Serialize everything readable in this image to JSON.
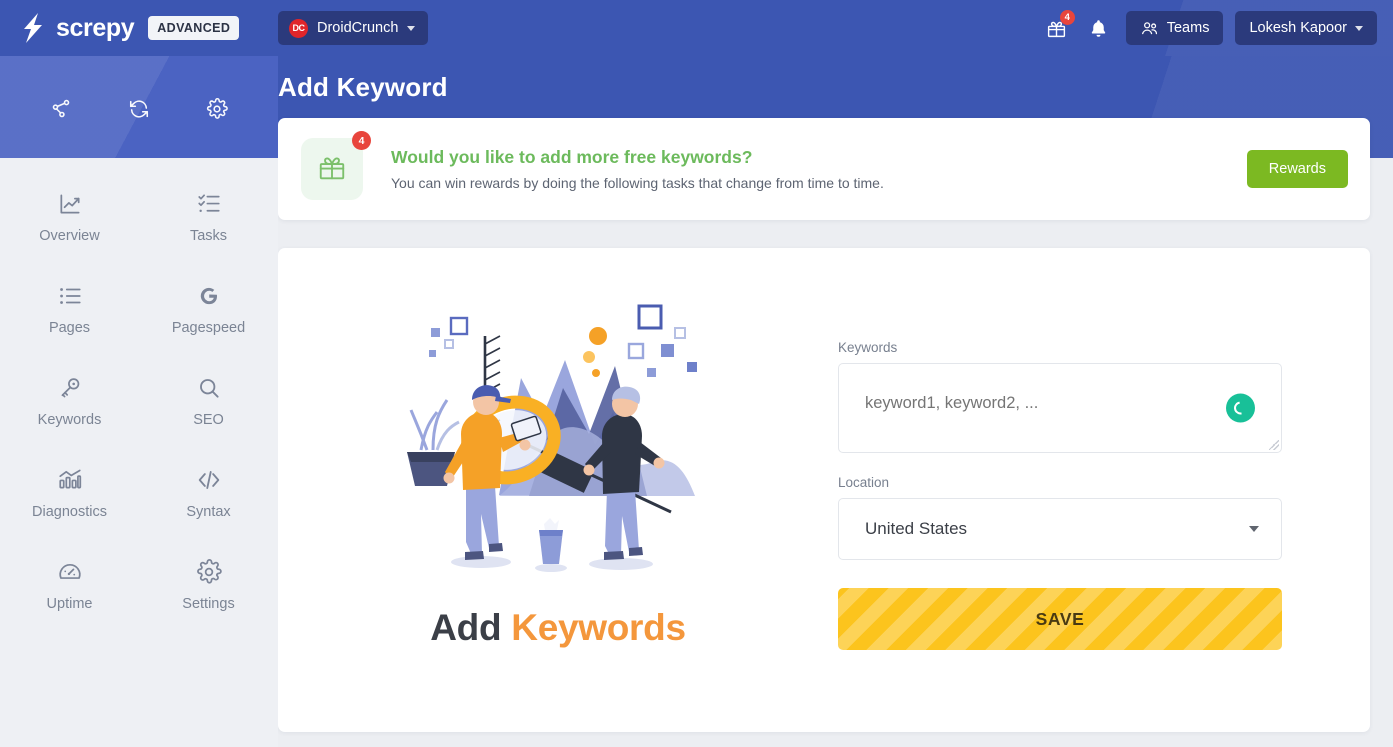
{
  "brand": {
    "name": "screpy",
    "plan_badge": "ADVANCED",
    "logo_icon": "lightning-bolt-icon"
  },
  "topbar": {
    "site_selector": {
      "favicon_text": "DC",
      "label": "DroidCrunch",
      "caret_icon": "chevron-down-icon"
    },
    "gift_icon": "gift-icon",
    "gift_badge_count": "4",
    "bell_icon": "bell-icon",
    "teams_label": "Teams",
    "teams_icon": "users-icon",
    "account_label": "Lokesh Kapoor",
    "account_caret_icon": "chevron-down-icon"
  },
  "sidebar": {
    "tools": [
      {
        "name": "site-structure-icon",
        "title": "Site Structure"
      },
      {
        "name": "refresh-icon",
        "title": "Refresh"
      },
      {
        "name": "gear-icon",
        "title": "Settings"
      }
    ],
    "items": [
      {
        "label": "Overview",
        "icon": "chart-line-icon"
      },
      {
        "label": "Tasks",
        "icon": "checklist-icon"
      },
      {
        "label": "Pages",
        "icon": "list-icon"
      },
      {
        "label": "Pagespeed",
        "icon": "google-g-icon"
      },
      {
        "label": "Keywords",
        "icon": "key-icon"
      },
      {
        "label": "SEO",
        "icon": "search-icon"
      },
      {
        "label": "Diagnostics",
        "icon": "bar-chart-icon"
      },
      {
        "label": "Syntax",
        "icon": "code-icon"
      },
      {
        "label": "Uptime",
        "icon": "gauge-icon"
      },
      {
        "label": "Settings",
        "icon": "gear-icon"
      }
    ]
  },
  "page": {
    "title": "Add Keyword"
  },
  "banner": {
    "gift_icon": "gift-icon",
    "badge_count": "4",
    "title": "Would you like to add more free keywords?",
    "subtitle": "You can win rewards by doing the following tasks that change from time to time.",
    "button_label": "Rewards"
  },
  "main": {
    "illustration_name": "people-with-magnifier-illustration",
    "caption_word1": "Add",
    "caption_word2": "Keywords",
    "keywords_label": "Keywords",
    "keywords_placeholder": "keyword1, keyword2, ...",
    "keywords_value": "",
    "keywords_spinner_icon": "loading-spinner-icon",
    "location_label": "Location",
    "location_value": "United States",
    "save_label": "SAVE"
  },
  "colors": {
    "brand_blue": "#3c56b2",
    "sidebar_blue": "#4b63c2",
    "sidebar_bg": "#eef0f4",
    "accent_green": "#7cb922",
    "banner_green": "#6cba5c",
    "badge_red": "#e8453c",
    "save_yellow": "#fcc41d",
    "caption_orange": "#f4973c",
    "spinner_teal": "#18c098",
    "navy_pill": "#2b3a7c"
  }
}
